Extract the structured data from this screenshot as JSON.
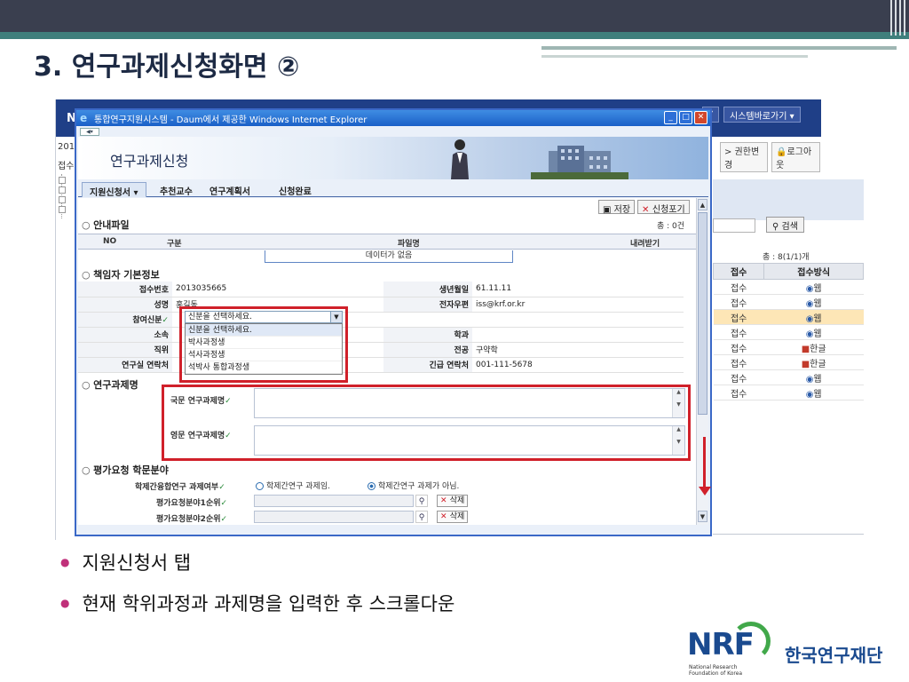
{
  "slide": {
    "title": "3. 연구과제신청화면 ②"
  },
  "background_app": {
    "header_left": "N",
    "sys_btn_1": "▾",
    "sys_btn_2": "시스템바로가기 ▾",
    "links": [
      "> 권한변경",
      "로그아웃"
    ],
    "left_num": "2013",
    "left_label": "접수",
    "search_button": "검색",
    "count": "총 : 8(1/1)개",
    "table_headers": [
      "접수",
      "접수방식"
    ],
    "rows": [
      {
        "status": "접수",
        "method": "웹",
        "kind": "web"
      },
      {
        "status": "접수",
        "method": "웹",
        "kind": "web"
      },
      {
        "status": "접수",
        "method": "웹",
        "kind": "web",
        "selected": true
      },
      {
        "status": "접수",
        "method": "웹",
        "kind": "web"
      },
      {
        "status": "접수",
        "method": "한글",
        "kind": "hangul"
      },
      {
        "status": "접수",
        "method": "한글",
        "kind": "hangul"
      },
      {
        "status": "접수",
        "method": "웹",
        "kind": "web"
      },
      {
        "status": "접수",
        "method": "웹",
        "kind": "web"
      }
    ]
  },
  "window": {
    "title": "통합연구지원시스템 - Daum에서 제공한 Windows Internet Explorer",
    "banner_title": "연구과제신청",
    "tabs": [
      "지원신청서 ▾",
      "추천교수",
      "연구계획서",
      "신청완료"
    ],
    "save_button": "저장",
    "cancel_button": "신청포기",
    "guide_section": "안내파일",
    "guide_count": "총 : 0건",
    "guide_headers": [
      "NO",
      "구분",
      "파일명",
      "내려받기"
    ],
    "guide_empty": "데이터가 없음",
    "owner_section": "책임자 기본정보",
    "fields": {
      "receipt_no_label": "접수번호",
      "receipt_no": "2013035665",
      "birth_label": "생년월일",
      "birth": "61.11.11",
      "name_label": "성명",
      "name": "홍길동",
      "email_label": "전자우편",
      "email": "iss@krf.or.kr",
      "role_label": "참여신분",
      "affiliation_label": "소속",
      "dept_label": "학과",
      "position_label": "직위",
      "major_label": "전공",
      "major": "구약학",
      "lab_contact_label": "연구실 연락처",
      "emergency_label": "긴급 연락처",
      "emergency": "001-111-5678"
    },
    "role_select": {
      "selected": "신분을 선택하세요.",
      "options": [
        "신분을 선택하세요.",
        "박사과정생",
        "석사과정생",
        "석박사 통합과정생"
      ]
    },
    "title_section": "연구과제명",
    "kr_title_label": "국문 연구과제명",
    "en_title_label": "영문 연구과제명",
    "eval_section": "평가요청 학문분야",
    "interdisciplinary_label": "학제간융합연구 과제여부",
    "radio_yes": "학제간연구 과제임.",
    "radio_no": "학제간연구 과제가 아님.",
    "field1_label": "평가요청분야1순위",
    "field2_label": "평가요청분야2순위",
    "delete_label": "삭제"
  },
  "bullets": [
    "지원신청서 탭",
    "현재 학위과정과 과제명을 입력한 후 스크롤다운"
  ],
  "logo": {
    "abbr": "NRF",
    "name": "한국연구재단",
    "sub1": "National Research",
    "sub2": "Foundation of Korea"
  }
}
